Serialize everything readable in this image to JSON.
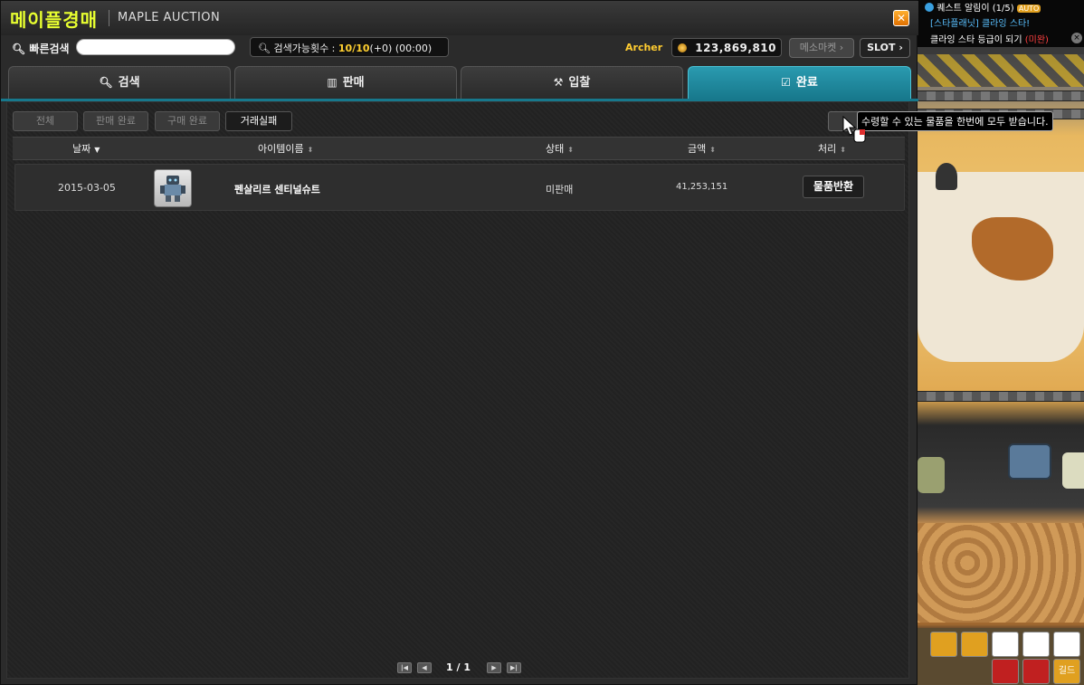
{
  "window": {
    "title_ko": "메이플경매",
    "title_en": "MAPLE AUCTION",
    "close_glyph": "✕"
  },
  "search_row": {
    "quick_search_label": "빠른검색",
    "quick_search_value": "",
    "count_label": "검색가능횟수 :",
    "count_value": "10/10",
    "count_extra": "(+0) (00:00)",
    "character": "Archer",
    "meso": "123,869,810",
    "meso_market_label": "메소마켓",
    "slot_label": "SLOT"
  },
  "tabs": [
    {
      "label": "검색",
      "icon": "search-icon"
    },
    {
      "label": "판매",
      "icon": "bars-icon"
    },
    {
      "label": "입찰",
      "icon": "gavel-icon"
    },
    {
      "label": "완료",
      "icon": "check-icon",
      "active": true
    }
  ],
  "subtabs": [
    {
      "label": "전체"
    },
    {
      "label": "판매 완료"
    },
    {
      "label": "구매 완료"
    },
    {
      "label": "거래실패",
      "active": true
    }
  ],
  "tooltip": "수령할 수 있는 물품을 한번에 모두 받습니다.",
  "table": {
    "headers": [
      "날짜",
      "아이템이름",
      "상태",
      "금액",
      "처리"
    ],
    "rows": [
      {
        "date": "2015-03-05",
        "item_name": "펜살리르 센티널슈트",
        "status": "미판매",
        "price": "41,253,151",
        "action": "물품반환"
      }
    ]
  },
  "pager": {
    "text": "1 / 1"
  },
  "quest": {
    "title": "퀘스트 알림이 (1/5)",
    "auto": "AUTO",
    "quest_name": "[스타플래닛] 클라잉 스타!",
    "objective": "클라잉 스타 등급이 되기",
    "status": "(미완)"
  },
  "quickslot": {
    "guild": "길드"
  },
  "colors": {
    "title_accent": "#e8ff30",
    "active_tab": "#1e8ca0",
    "archer": "#ffcc30",
    "count_highlight": "#ffd030"
  }
}
